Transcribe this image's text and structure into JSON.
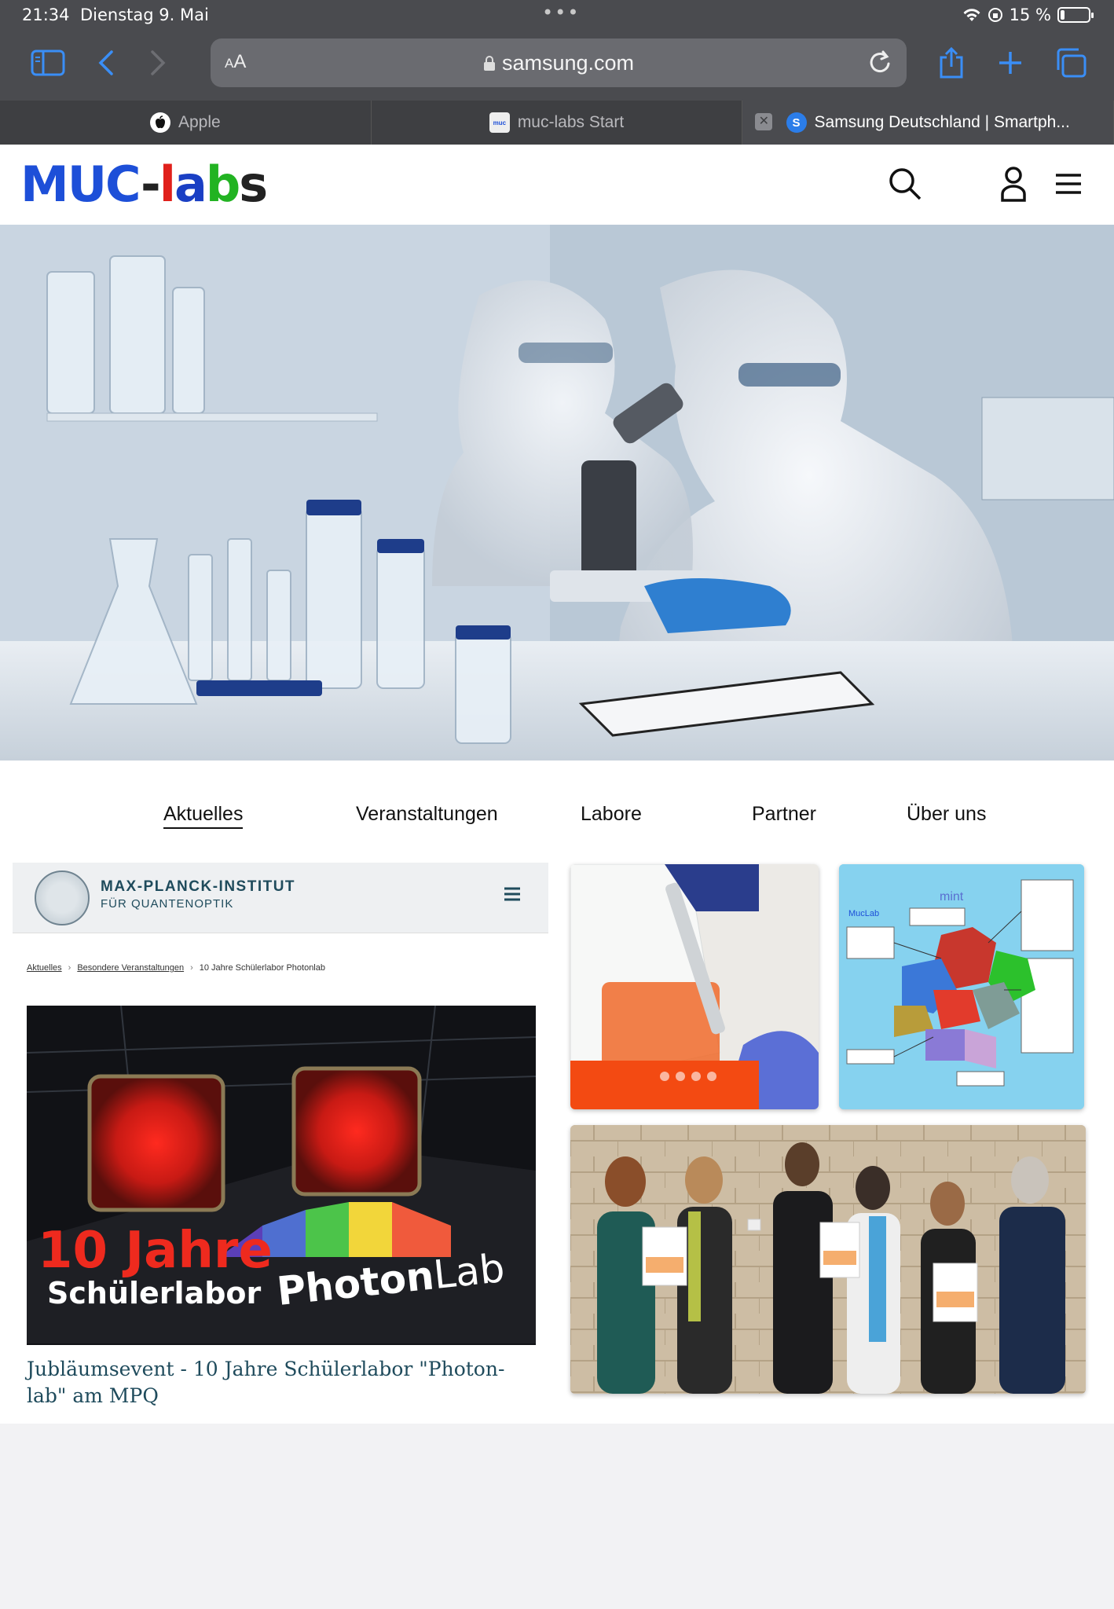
{
  "status_bar": {
    "time": "21:34",
    "date": "Dienstag 9. Mai",
    "battery": "15 %",
    "battery_level": 0.15
  },
  "browser": {
    "text_size_button": "AA",
    "url": "samsung.com",
    "tabs": [
      {
        "title": "Apple",
        "favicon": "apple-icon",
        "active": false
      },
      {
        "title": "muc-labs Start",
        "favicon": "muc-labs-icon",
        "active": false
      },
      {
        "title": "Samsung Deutschland | Smartph...",
        "favicon": "S",
        "active": true
      }
    ]
  },
  "site": {
    "logo_text": "MUC-labs",
    "logo_colors": {
      "muc": "#1d4fd8",
      "dash": "#222222",
      "l": "#e0201b",
      "a": "#1a3fc4",
      "b": "#22b322",
      "s": "#222222"
    },
    "nav": [
      "Aktuelles",
      "Veranstaltungen",
      "Labore",
      "Partner",
      "Über uns"
    ],
    "active_nav": "Aktuelles"
  },
  "news": {
    "institute_name": "MAX-PLANCK-INSTITUT",
    "institute_sub": "FÜR QUANTENOPTIK",
    "breadcrumb": [
      "Aktuelles",
      "Besondere Veranstaltungen",
      "10 Jahre Schülerlabor Photonlab"
    ],
    "image_headline_1": "10 Jahre",
    "image_headline_2": "Schülerlabor",
    "image_brand_1": "Photon",
    "image_brand_2": "Lab",
    "title": "Jubläumsevent - 10 Jahre Schülerlabor \"Photon-lab\" am MPQ"
  },
  "tiles": {
    "map_label": "MucLab",
    "map_logo": "mint"
  }
}
